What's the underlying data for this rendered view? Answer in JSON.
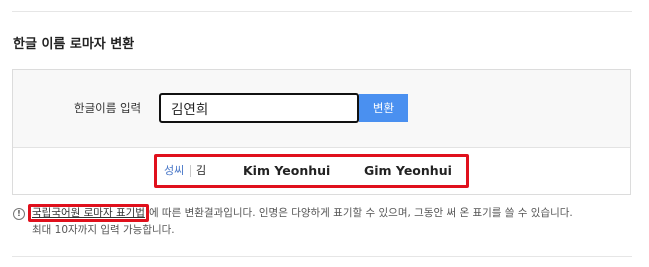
{
  "section": {
    "title": "한글 이름 로마자 변환"
  },
  "form": {
    "label": "한글이름 입력",
    "input_value": "김연희",
    "convert_button": "변환"
  },
  "result": {
    "surname_label": "성씨",
    "surname_value": "김",
    "romanizations": [
      "Kim Yeonhui",
      "Gim Yeonhui"
    ]
  },
  "notice": {
    "icon": "exclamation-icon",
    "link_text": "국립국어원 로마자 표기법",
    "text_after_link": "에 따른 변환결과입니다. 인명은 다양하게 표기할 수 있으며, 그동안 써 온 표기를 쓸 수 있습니다.",
    "second_line": "최대 10자까지 입력 가능합니다."
  },
  "colors": {
    "accent": "#4a90f0",
    "highlight": "#e0101c",
    "surname_label": "#4a78c8"
  }
}
